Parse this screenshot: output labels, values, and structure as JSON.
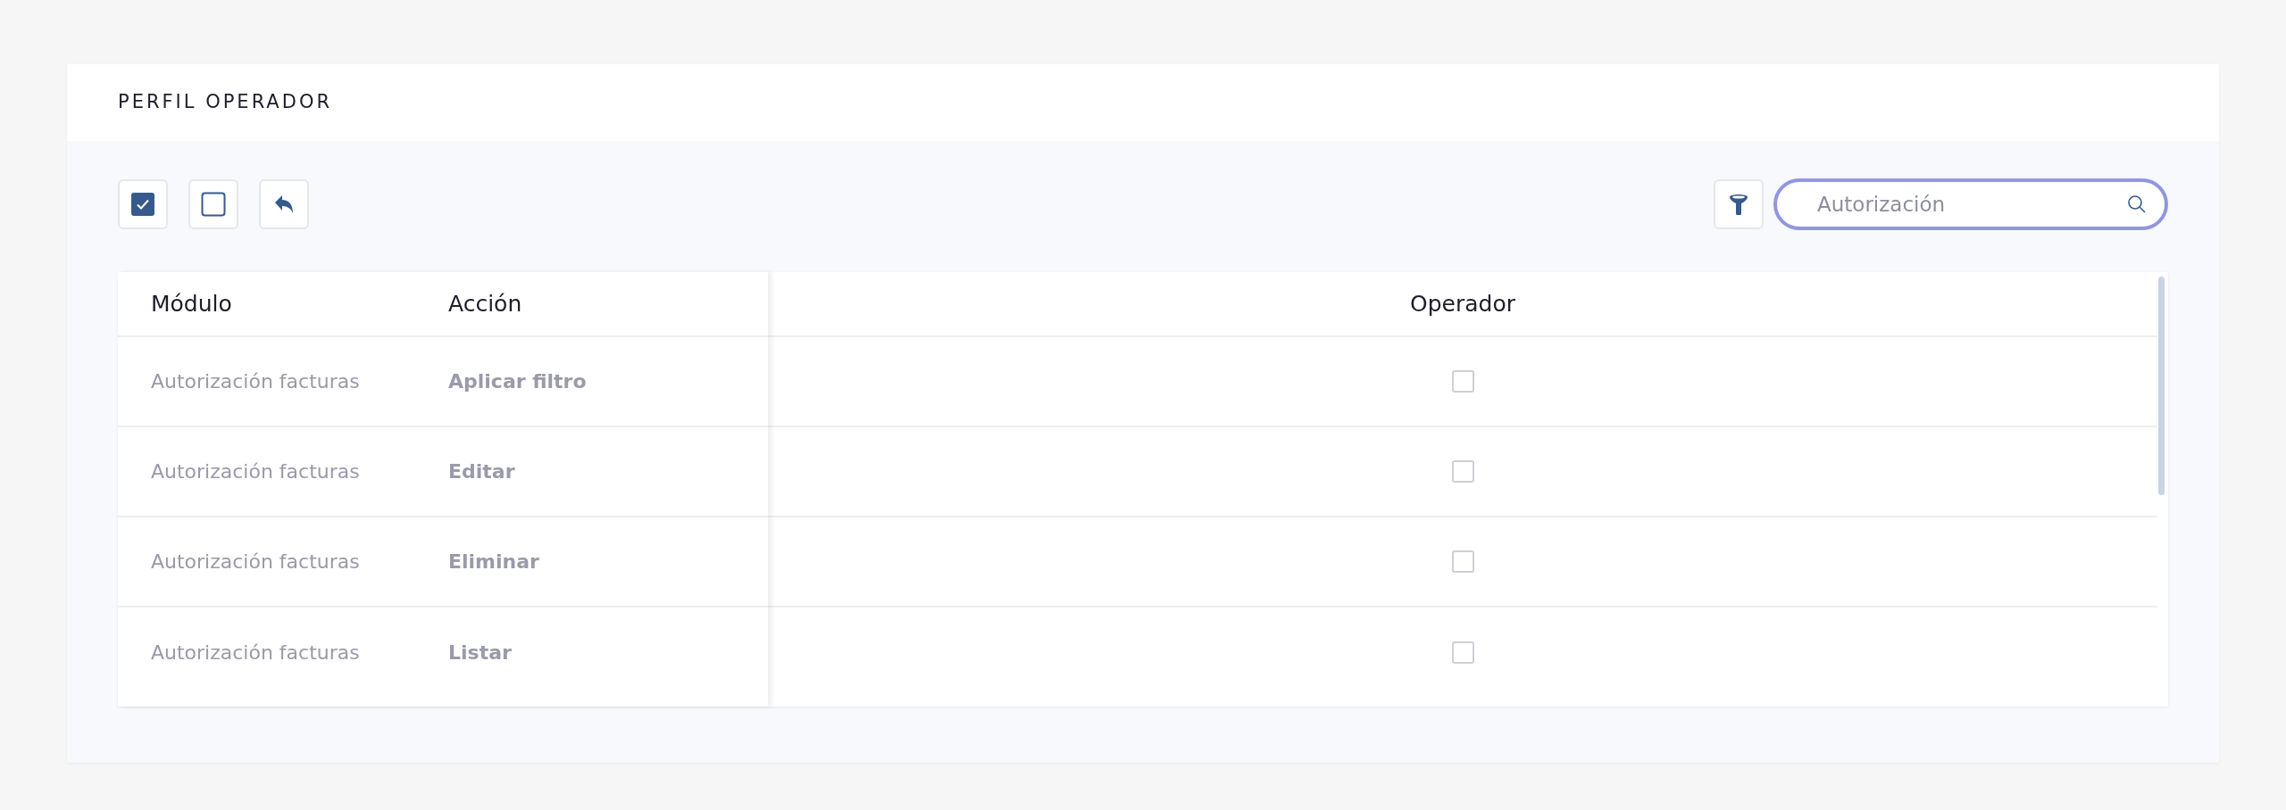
{
  "panel": {
    "title": "PERFIL OPERADOR"
  },
  "toolbar": {
    "buttons": [
      {
        "kind": "check_all"
      },
      {
        "kind": "uncheck_all"
      },
      {
        "kind": "undo"
      }
    ],
    "filter_button": {
      "kind": "filter"
    },
    "search": {
      "value": "Autorización",
      "focused": true
    }
  },
  "table": {
    "columns": [
      "Módulo",
      "Acción",
      "Operador"
    ],
    "rows": [
      {
        "module": "Autorización facturas",
        "action": "Aplicar filtro",
        "checked": false
      },
      {
        "module": "Autorización facturas",
        "action": "Editar",
        "checked": false
      },
      {
        "module": "Autorización facturas",
        "action": "Eliminar",
        "checked": false
      },
      {
        "module": "Autorización facturas",
        "action": "Listar",
        "checked": false
      }
    ]
  }
}
